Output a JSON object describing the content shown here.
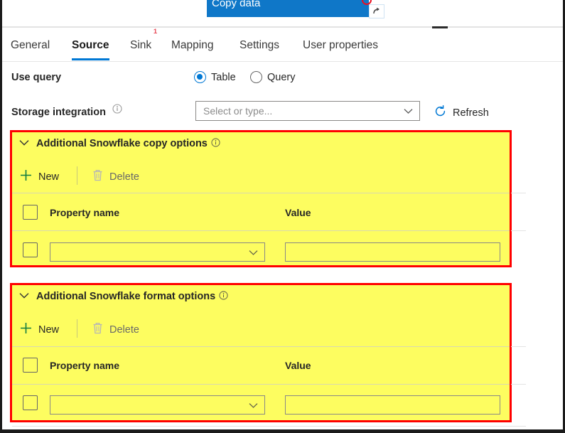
{
  "window": {
    "title": "Copy data",
    "open_icon": "open-in-new-icon",
    "close_icon": "close-circle-icon",
    "minimize_icon": "minimize-icon"
  },
  "tabs": [
    {
      "label": "General",
      "active": false,
      "badge": null
    },
    {
      "label": "Source",
      "active": true,
      "badge": null
    },
    {
      "label": "Sink",
      "active": false,
      "badge": "1"
    },
    {
      "label": "Mapping",
      "active": false,
      "badge": null
    },
    {
      "label": "Settings",
      "active": false,
      "badge": null
    },
    {
      "label": "User properties",
      "active": false,
      "badge": null
    }
  ],
  "use_query": {
    "label": "Use query",
    "options": [
      {
        "label": "Table",
        "selected": true
      },
      {
        "label": "Query",
        "selected": false
      }
    ]
  },
  "storage_integration": {
    "label": "Storage integration",
    "info_icon": "info-icon",
    "placeholder": "Select or type...",
    "value": "",
    "chevron_icon": "chevron-down-icon",
    "refresh": {
      "label": "Refresh",
      "icon": "refresh-icon",
      "icon_color": "#0078d4"
    }
  },
  "highlight": {
    "border_color": "#ff0000",
    "fill_color": "#fdfd60"
  },
  "sections": [
    {
      "title": "Additional Snowflake copy options",
      "chevron_icon": "chevron-down-icon",
      "info_icon": "info-icon",
      "toolbar": {
        "new_label": "New",
        "new_icon": "plus-icon",
        "new_icon_color": "#107c41",
        "delete_label": "Delete",
        "delete_icon": "trash-icon",
        "delete_icon_color": "#b6b6b6"
      },
      "columns": [
        "Property name",
        "Value"
      ],
      "rows": [
        {
          "selected": false,
          "property_name": "",
          "value": ""
        }
      ]
    },
    {
      "title": "Additional Snowflake format options",
      "chevron_icon": "chevron-down-icon",
      "info_icon": "info-icon",
      "toolbar": {
        "new_label": "New",
        "new_icon": "plus-icon",
        "new_icon_color": "#107c41",
        "delete_label": "Delete",
        "delete_icon": "trash-icon",
        "delete_icon_color": "#b6b6b6"
      },
      "columns": [
        "Property name",
        "Value"
      ],
      "rows": [
        {
          "selected": false,
          "property_name": "",
          "value": ""
        }
      ]
    }
  ]
}
